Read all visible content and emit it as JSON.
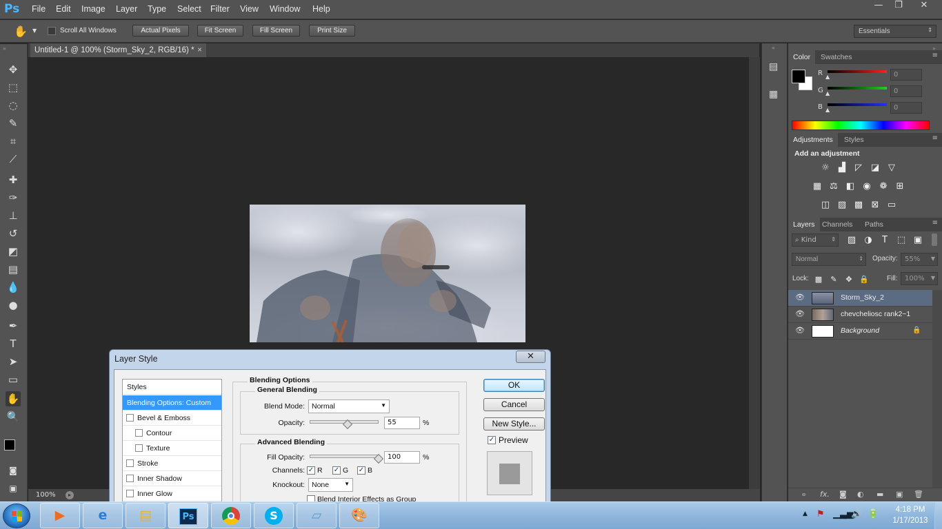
{
  "app": {
    "logo": "Ps"
  },
  "menu": [
    "File",
    "Edit",
    "Image",
    "Layer",
    "Type",
    "Select",
    "Filter",
    "View",
    "Window",
    "Help"
  ],
  "window_controls": {
    "minimize": "—",
    "restore": "❐",
    "close": "✕"
  },
  "options_bar": {
    "scroll_all_windows": "Scroll All Windows",
    "actual_pixels": "Actual Pixels",
    "fit_screen": "Fit Screen",
    "fill_screen": "Fill Screen",
    "print_size": "Print Size",
    "workspace": "Essentials"
  },
  "document": {
    "tab_title": "Untitled-1 @ 100% (Storm_Sky_2, RGB/16) *",
    "zoom": "100%"
  },
  "color_panel": {
    "tabs": [
      "Color",
      "Swatches"
    ],
    "channels": [
      {
        "label": "R",
        "value": "0",
        "color": "#ff2020"
      },
      {
        "label": "G",
        "value": "0",
        "color": "#20d020"
      },
      {
        "label": "B",
        "value": "0",
        "color": "#2030ff"
      }
    ]
  },
  "adjustments_panel": {
    "tabs": [
      "Adjustments",
      "Styles"
    ],
    "heading": "Add an adjustment"
  },
  "layers_panel": {
    "tabs": [
      "Layers",
      "Channels",
      "Paths"
    ],
    "kind_label": "Kind",
    "blend_mode": "Normal",
    "opacity_label": "Opacity:",
    "opacity_value": "55%",
    "lock_label": "Lock:",
    "fill_label": "Fill:",
    "fill_value": "100%",
    "layers": [
      {
        "name": "Storm_Sky_2",
        "selected": true
      },
      {
        "name": "chevcheliosc rank2~1",
        "selected": false
      },
      {
        "name": "Background",
        "selected": false
      }
    ]
  },
  "layer_style_dialog": {
    "title": "Layer Style",
    "close": "✕",
    "styles_header": "Styles",
    "style_items": [
      {
        "label": "Blending Options: Custom",
        "selected": true,
        "checkbox": false
      },
      {
        "label": "Bevel & Emboss",
        "checkbox": true
      },
      {
        "label": "Contour",
        "checkbox": true,
        "indent": true
      },
      {
        "label": "Texture",
        "checkbox": true,
        "indent": true
      },
      {
        "label": "Stroke",
        "checkbox": true
      },
      {
        "label": "Inner Shadow",
        "checkbox": true
      },
      {
        "label": "Inner Glow",
        "checkbox": true
      }
    ],
    "blending_options": "Blending Options",
    "general_blending": "General Blending",
    "blend_mode_label": "Blend Mode:",
    "blend_mode_value": "Normal",
    "opacity_label": "Opacity:",
    "opacity_value": "55",
    "opacity_fraction": 0.55,
    "percent": "%",
    "advanced_blending": "Advanced Blending",
    "fill_opacity_label": "Fill Opacity:",
    "fill_opacity_value": "100",
    "fill_opacity_fraction": 1.0,
    "channels_label": "Channels:",
    "channels": [
      "R",
      "G",
      "B"
    ],
    "knockout_label": "Knockout:",
    "knockout_value": "None",
    "blend_interior": "Blend Interior Effects as Group",
    "ok": "OK",
    "cancel": "Cancel",
    "new_style": "New Style...",
    "preview": "Preview"
  },
  "taskbar": {
    "time": "4:18 PM",
    "date": "1/17/2013",
    "ps_label": "Ps"
  }
}
